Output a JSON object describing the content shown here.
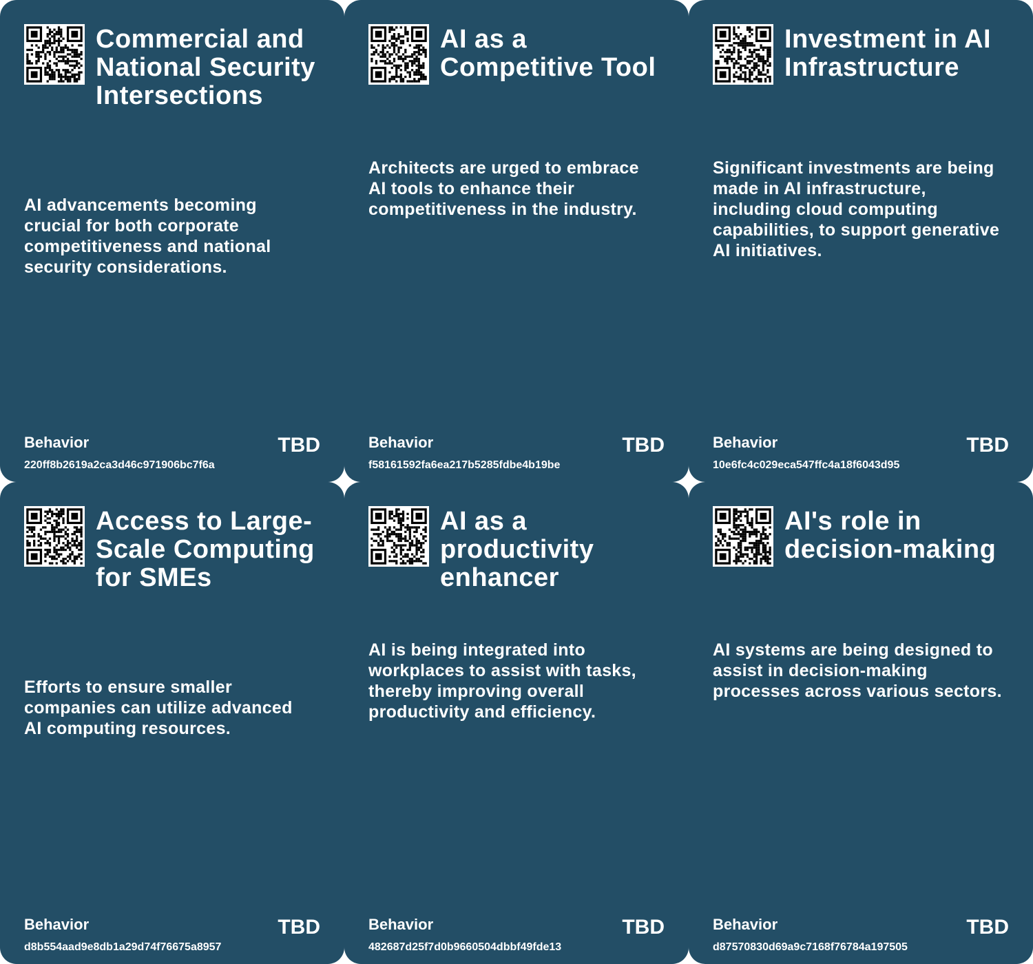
{
  "colors": {
    "card_background": "#234e66",
    "text": "#ffffff",
    "page_background": "#ffffff"
  },
  "cards": [
    {
      "title": "Commercial and National Security Intersections",
      "description": "AI advancements becoming crucial for both corporate competitiveness and national security considerations.",
      "category": "Behavior",
      "status": "TBD",
      "hash": "220ff8b2619a2ca3d46c971906bc7f6a"
    },
    {
      "title": "AI as a Competitive Tool",
      "description": "Architects are urged to embrace AI tools to enhance their competitiveness in the industry.",
      "category": "Behavior",
      "status": "TBD",
      "hash": "f58161592fa6ea217b5285fdbe4b19be"
    },
    {
      "title": "Investment in AI Infrastructure",
      "description": "Significant investments are being made in AI infrastructure, including cloud computing capabilities, to support generative AI initiatives.",
      "category": "Behavior",
      "status": "TBD",
      "hash": "10e6fc4c029eca547ffc4a18f6043d95"
    },
    {
      "title": "Access to Large-Scale Computing for SMEs",
      "description": "Efforts to ensure smaller companies can utilize advanced AI computing resources.",
      "category": "Behavior",
      "status": "TBD",
      "hash": "d8b554aad9e8db1a29d74f76675a8957"
    },
    {
      "title": "AI as a productivity enhancer",
      "description": "AI is being integrated into workplaces to assist with tasks, thereby improving overall productivity and efficiency.",
      "category": "Behavior",
      "status": "TBD",
      "hash": "482687d25f7d0b9660504dbbf49fde13"
    },
    {
      "title": "AI's role in decision-making",
      "description": "AI systems are being designed to assist in decision-making processes across various sectors.",
      "category": "Behavior",
      "status": "TBD",
      "hash": "d87570830d69a9c7168f76784a197505"
    }
  ]
}
